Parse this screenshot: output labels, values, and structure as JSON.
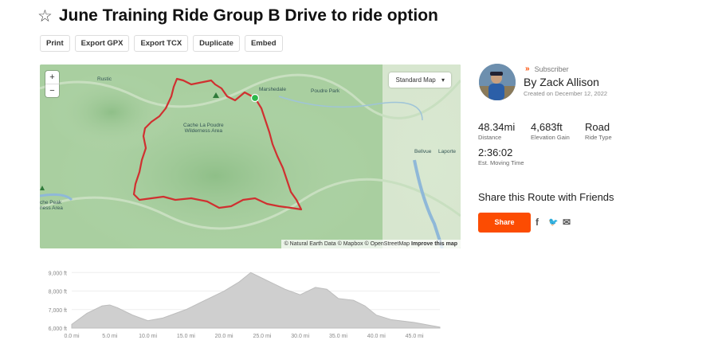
{
  "header": {
    "star_icon": "star-outline-icon",
    "title": "June Training Ride Group B Drive to ride option"
  },
  "actions": [
    "Print",
    "Export GPX",
    "Export TCX",
    "Duplicate",
    "Embed"
  ],
  "map": {
    "zoom_in": "+",
    "zoom_out": "−",
    "style_label": "Standard Map",
    "style_caret": "▾",
    "labels": {
      "rustic": "Rustic",
      "marshedale": "Marshedale",
      "poudre_park": "Poudre Park",
      "wilderness": "Cache La Poudre\nWilderness Area",
      "bellvue": "Bellvue",
      "laporte": "Laporte",
      "peak_area": "che Peak\nness Area"
    },
    "attribution_prefix": "© Natural Earth Data © Mapbox © OpenStreetMap",
    "attribution_link": "Improve this map"
  },
  "athlete": {
    "badge": "Subscriber",
    "name": "By Zack Allison",
    "created": "Created on December 12, 2022"
  },
  "stats": [
    {
      "value": "48.34mi",
      "label": "Distance"
    },
    {
      "value": "4,683ft",
      "label": "Elevation Gain"
    },
    {
      "value": "Road",
      "label": "Ride Type"
    },
    {
      "value": "2:36:02",
      "label": "Est. Moving Time"
    }
  ],
  "share": {
    "title": "Share this Route with Friends",
    "button": "Share",
    "facebook": "f",
    "twitter": "🐦",
    "email": "✉"
  },
  "chart_data": {
    "type": "area",
    "xlabel": "",
    "ylabel": "",
    "x_ticks": [
      "0.0 mi",
      "5.0 mi",
      "10.0 mi",
      "15.0 mi",
      "20.0 mi",
      "25.0 mi",
      "30.0 mi",
      "35.0 mi",
      "40.0 mi",
      "45.0 mi"
    ],
    "y_ticks": [
      "9,000 ft",
      "8,000 ft",
      "7,000 ft",
      "6,000 ft"
    ],
    "xlim": [
      0,
      48.34
    ],
    "ylim": [
      6000,
      9400
    ],
    "x": [
      0,
      2,
      4,
      5,
      6,
      8,
      10,
      12,
      15,
      18,
      20,
      22,
      23.5,
      24,
      26,
      28,
      30,
      32,
      33.5,
      35,
      37,
      38.5,
      40,
      42,
      45,
      47,
      48.34
    ],
    "y": [
      6200,
      6800,
      7200,
      7250,
      7100,
      6700,
      6400,
      6550,
      7000,
      7600,
      8000,
      8500,
      9000,
      8900,
      8500,
      8100,
      7800,
      8200,
      8100,
      7600,
      7500,
      7200,
      6700,
      6450,
      6300,
      6150,
      6050
    ]
  }
}
